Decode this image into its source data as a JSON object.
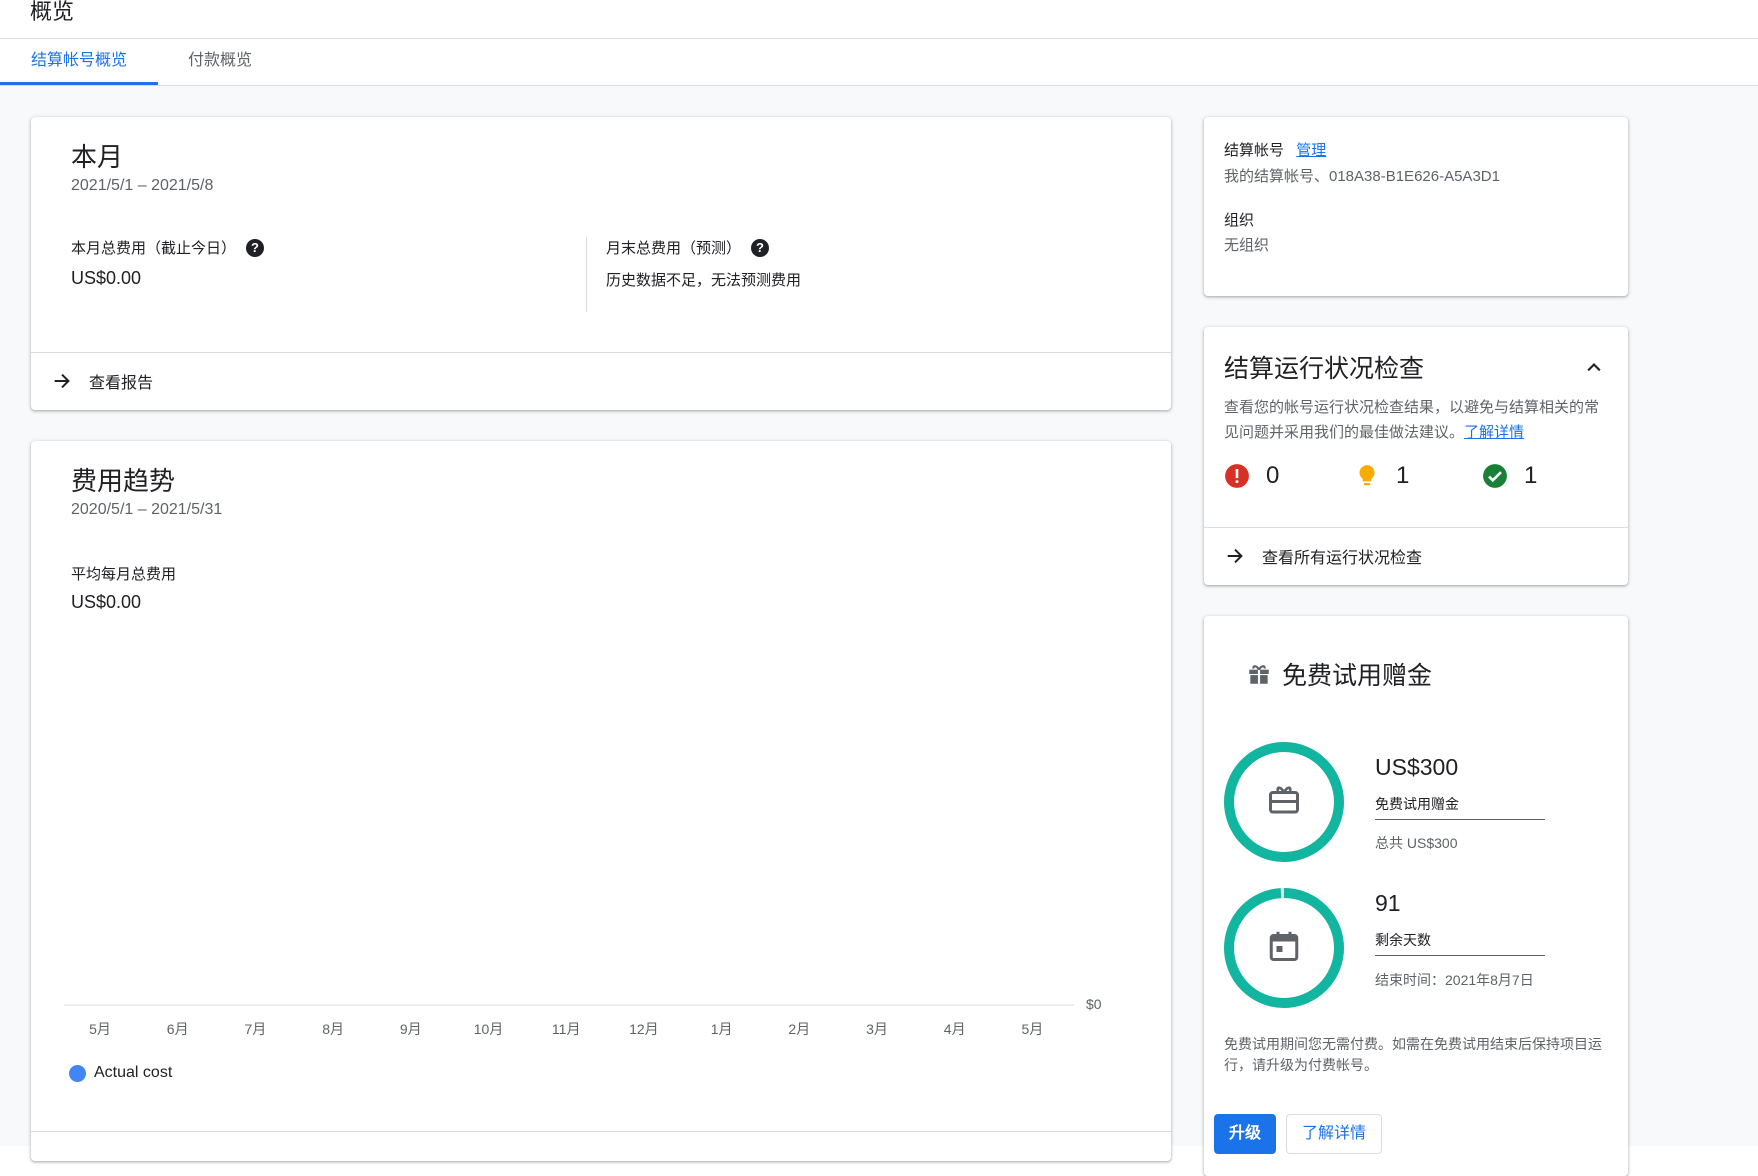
{
  "header": {
    "title": "概览"
  },
  "tabs": [
    {
      "label": "结算帐号概览",
      "active": true
    },
    {
      "label": "付款概览",
      "active": false
    }
  ],
  "this_month": {
    "title": "本月",
    "date_range": "2021/5/1 – 2021/5/8",
    "total_cost_label": "本月总费用（截止今日）",
    "total_cost_value": "US$0.00",
    "forecast_label": "月末总费用（预测）",
    "forecast_value": "历史数据不足，无法预测费用",
    "view_report": "查看报告"
  },
  "cost_trend": {
    "title": "费用趋势",
    "date_range": "2020/5/1 – 2021/5/31",
    "avg_label": "平均每月总费用",
    "avg_value": "US$0.00",
    "legend_label": "Actual cost"
  },
  "chart_data": {
    "type": "line",
    "categories": [
      "5月",
      "6月",
      "7月",
      "8月",
      "9月",
      "10月",
      "11月",
      "12月",
      "1月",
      "2月",
      "3月",
      "4月",
      "5月"
    ],
    "series": [
      {
        "name": "Actual cost",
        "values": [
          0,
          0,
          0,
          0,
          0,
          0,
          0,
          0,
          0,
          0,
          0,
          0,
          0
        ],
        "color": "#4285f4"
      }
    ],
    "y_tick_labels": [
      "$0"
    ],
    "ylim": [
      0,
      0
    ],
    "grid": false,
    "legend_position": "bottom-left"
  },
  "billing_account": {
    "label": "结算帐号",
    "manage_link": "管理",
    "account_value": "我的结算帐号、018A38-B1E626-A5A3D1",
    "org_label": "组织",
    "org_value": "无组织"
  },
  "health_check": {
    "title": "结算运行状况检查",
    "description": "查看您的帐号运行状况检查结果，以避免与结算相关的常见问题并采用我们的最佳做法建议。",
    "learn_more": "了解详情",
    "error_count": "0",
    "warning_count": "1",
    "ok_count": "1",
    "view_all": "查看所有运行状况检查"
  },
  "free_trial": {
    "title": "免费试用赠金",
    "credit_amount": "US$300",
    "credit_label": "免费试用赠金",
    "credit_total": "总共 US$300",
    "credit_fraction_remaining": 1.0,
    "days_remaining": "91",
    "days_label": "剩余天数",
    "end_date": "结束时间：2021年8月7日",
    "days_fraction_remaining": 0.99,
    "note": "免费试用期间您无需付费。如需在免费试用结束后保持项目运行，请升级为付费帐号。",
    "upgrade_button": "升级",
    "learn_more_button": "了解详情"
  },
  "colors": {
    "accent": "#1a73e8",
    "ring": "#12b5a0",
    "error": "#d93025",
    "warning": "#f9ab00",
    "ok": "#188038"
  }
}
